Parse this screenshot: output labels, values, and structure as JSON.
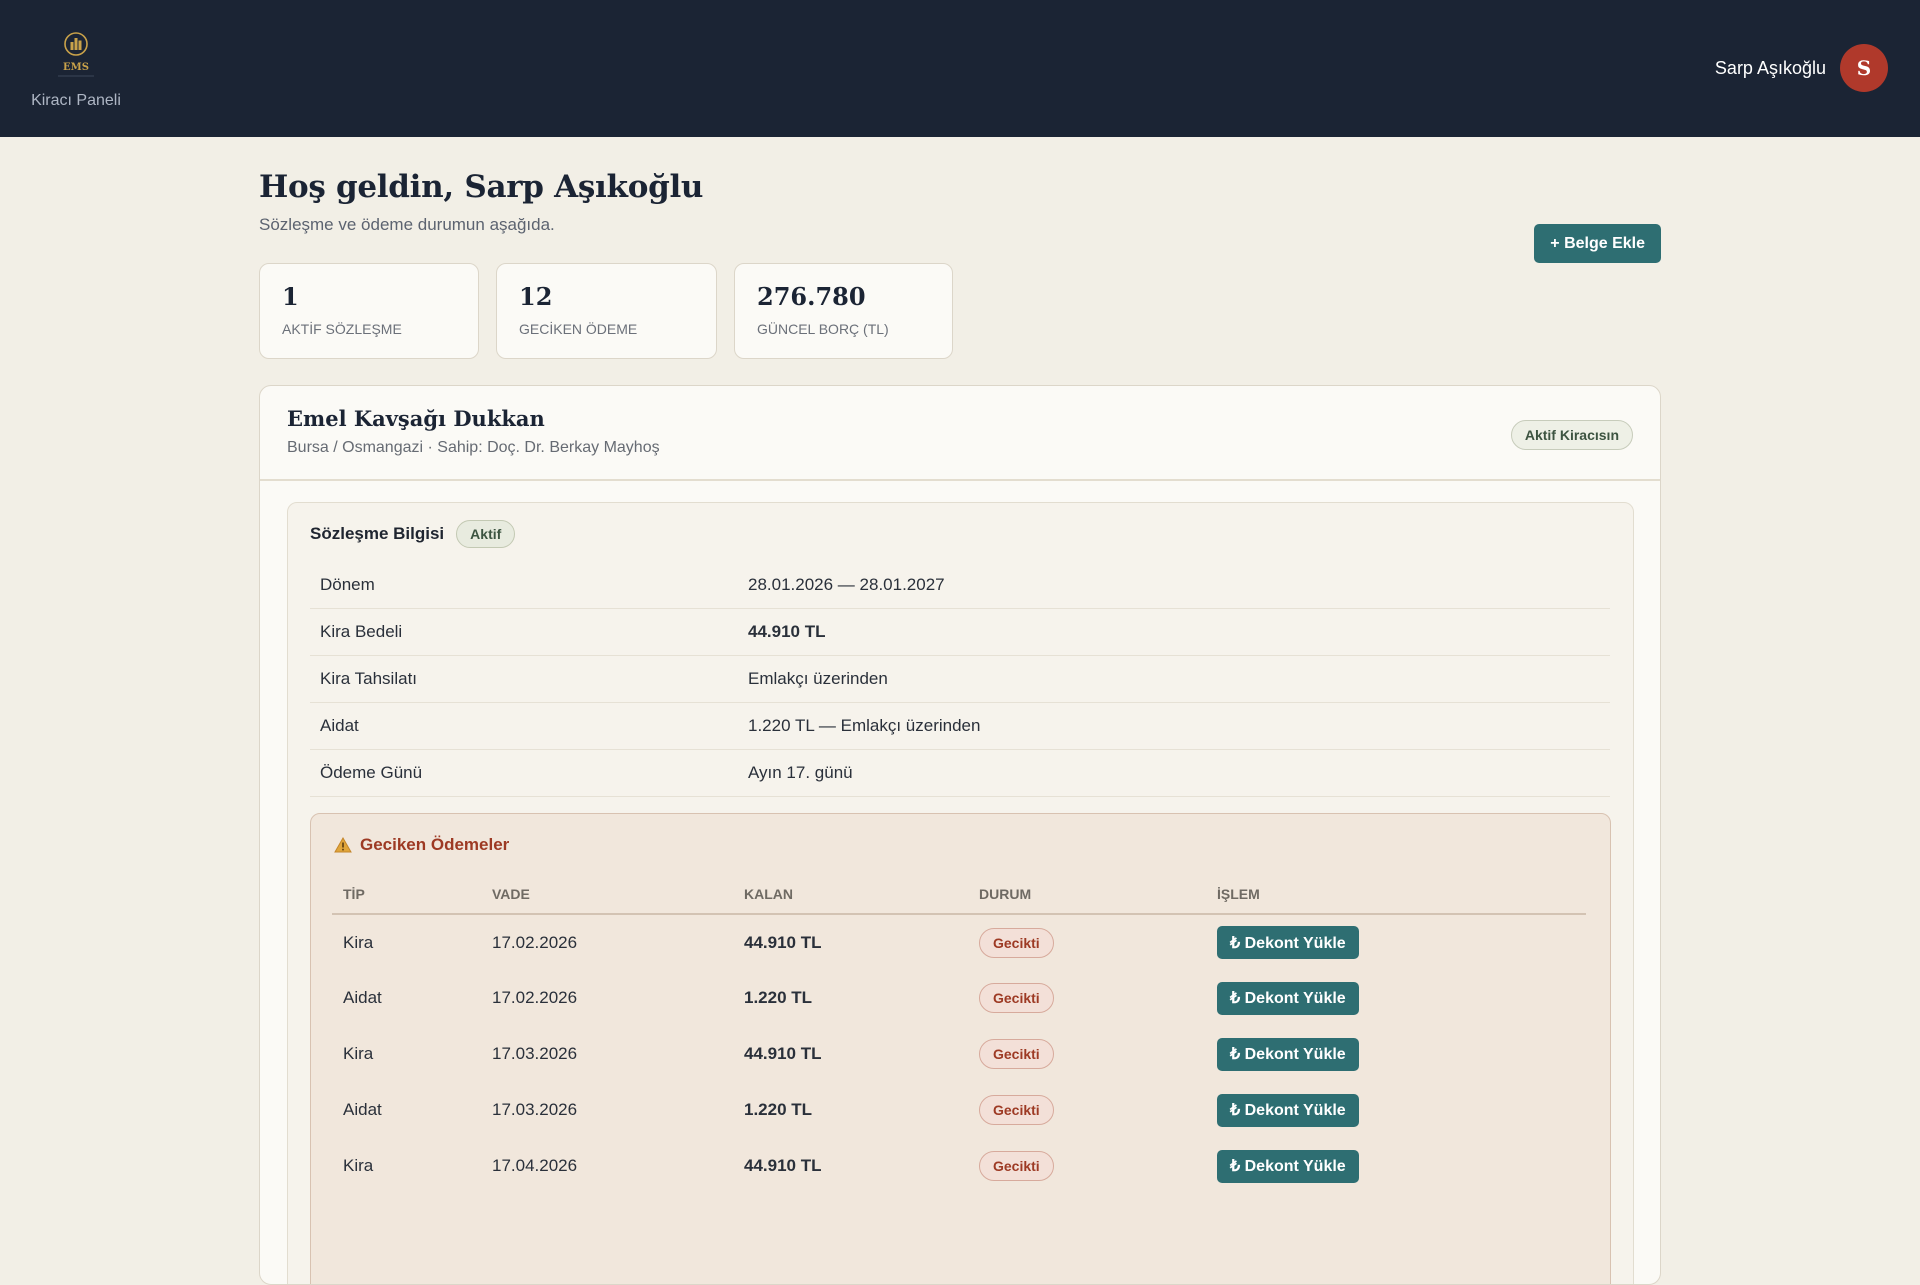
{
  "header": {
    "brand_text": "EMS",
    "panel_label": "Kiracı Paneli",
    "user_name": "Sarp Aşıkoğlu",
    "avatar_initial": "S",
    "colors": {
      "background": "#1b2434",
      "avatar": "#b0392b"
    }
  },
  "welcome": {
    "title": "Hoş geldin, Sarp Aşıkoğlu",
    "subtitle": "Sözleşme ve ödeme durumun aşağıda."
  },
  "actions": {
    "add_document_label": "+ Belge Ekle"
  },
  "stats": [
    {
      "value": "1",
      "label": "AKTİF SÖZLEŞME"
    },
    {
      "value": "12",
      "label": "GECİKEN ÖDEME"
    },
    {
      "value": "276.780",
      "label": "GÜNCEL BORÇ (TL)"
    }
  ],
  "property": {
    "name": "Emel Kavşağı Dukkan",
    "meta": "Bursa / Osmangazi · Sahip: Doç. Dr. Berkay Mayhoş",
    "tenant_status": "Aktif Kiracısın"
  },
  "contract": {
    "title": "Sözleşme Bilgisi",
    "status": "Aktif",
    "rows": [
      {
        "label": "Dönem",
        "value": "28.01.2026 — 28.01.2027"
      },
      {
        "label": "Kira Bedeli",
        "value": "44.910 TL"
      },
      {
        "label": "Kira Tahsilatı",
        "value": "Emlakçı üzerinden"
      },
      {
        "label": "Aidat",
        "value": "1.220 TL — Emlakçı üzerinden"
      },
      {
        "label": "Ödeme Günü",
        "value": "Ayın 17. günü"
      }
    ]
  },
  "late_payments": {
    "title": "Geciken Ödemeler",
    "icon": "warning-icon",
    "columns": [
      "TİP",
      "VADE",
      "KALAN",
      "DURUM",
      "İŞLEM"
    ],
    "rows": [
      {
        "type": "Kira",
        "due": "17.02.2026",
        "remaining": "44.910 TL",
        "status": "Gecikti",
        "action": "₺ Dekont Yükle"
      },
      {
        "type": "Aidat",
        "due": "17.02.2026",
        "remaining": "1.220 TL",
        "status": "Gecikti",
        "action": "₺ Dekont Yükle"
      },
      {
        "type": "Kira",
        "due": "17.03.2026",
        "remaining": "44.910 TL",
        "status": "Gecikti",
        "action": "₺ Dekont Yükle"
      },
      {
        "type": "Aidat",
        "due": "17.03.2026",
        "remaining": "1.220 TL",
        "status": "Gecikti",
        "action": "₺ Dekont Yükle"
      },
      {
        "type": "Kira",
        "due": "17.04.2026",
        "remaining": "44.910 TL",
        "status": "Gecikti",
        "action": "₺ Dekont Yükle"
      }
    ]
  },
  "theme": {
    "accent": "#2e6e72",
    "page_background": "#f2efe6",
    "danger": "#9d3a24"
  }
}
